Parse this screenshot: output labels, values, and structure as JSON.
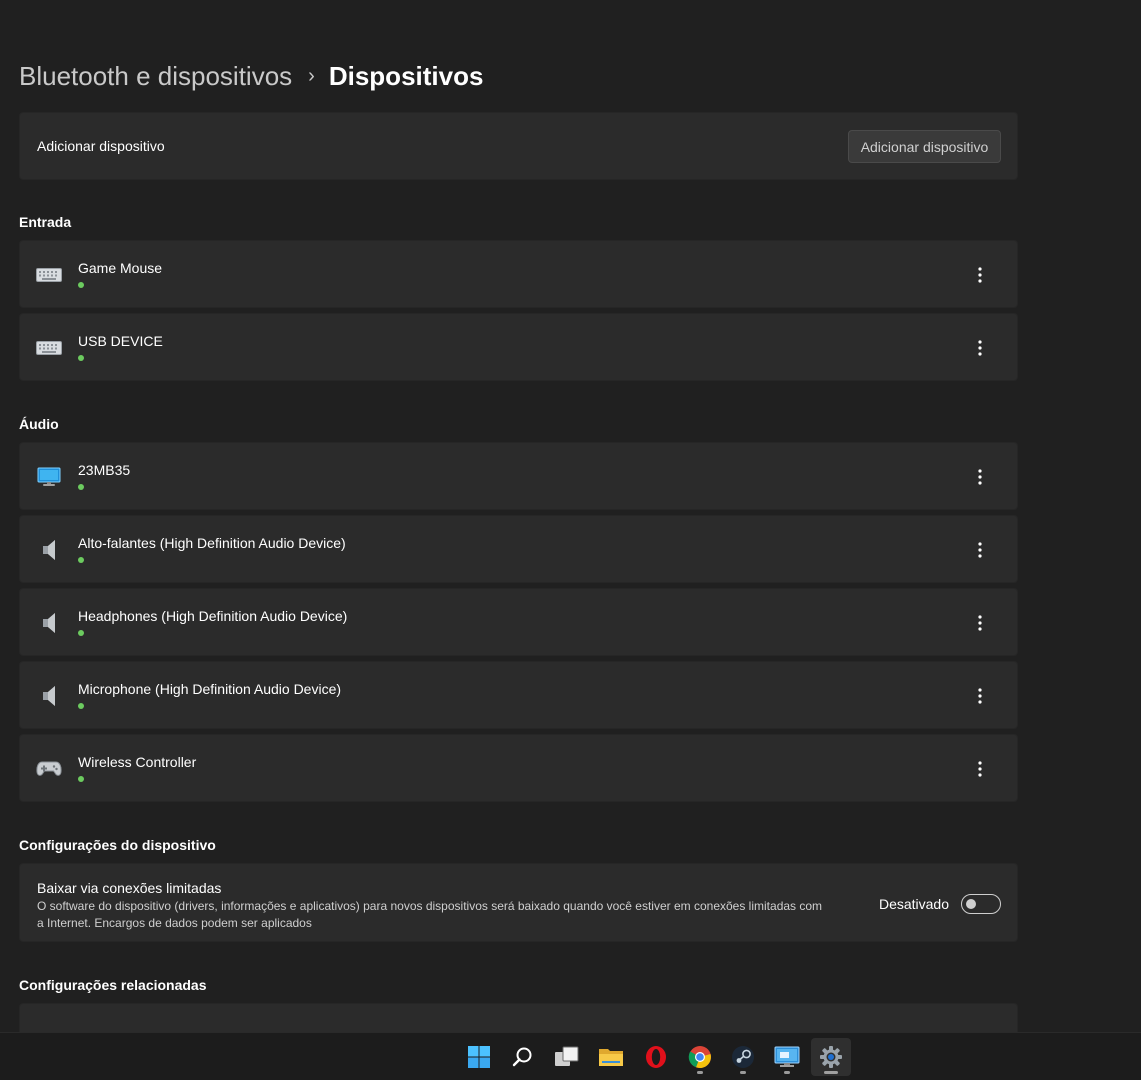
{
  "breadcrumb": {
    "parent": "Bluetooth e dispositivos",
    "separator": "›",
    "current": "Dispositivos"
  },
  "add_device": {
    "label": "Adicionar dispositivo",
    "button": "Adicionar dispositivo"
  },
  "sections": {
    "input": "Entrada",
    "audio": "Áudio",
    "device_settings": "Configurações do dispositivo",
    "related_settings": "Configurações relacionadas"
  },
  "input_devices": [
    {
      "name": "Game Mouse",
      "icon": "keyboard-icon",
      "status": "connected"
    },
    {
      "name": "USB DEVICE",
      "icon": "keyboard-icon",
      "status": "connected"
    }
  ],
  "audio_devices": [
    {
      "name": "23MB35",
      "icon": "monitor-icon",
      "status": "connected"
    },
    {
      "name": "Alto-falantes (High Definition Audio Device)",
      "icon": "speaker-icon",
      "status": "connected"
    },
    {
      "name": "Headphones (High Definition Audio Device)",
      "icon": "speaker-icon",
      "status": "connected"
    },
    {
      "name": "Microphone (High Definition Audio Device)",
      "icon": "speaker-icon",
      "status": "connected"
    },
    {
      "name": "Wireless Controller",
      "icon": "gamepad-icon",
      "status": "connected"
    }
  ],
  "metered_download": {
    "title": "Baixar via conexões limitadas",
    "description": "O software do dispositivo (drivers, informações e aplicativos) para novos dispositivos será baixado quando você estiver em conexões limitadas com a Internet. Encargos de dados podem ser aplicados",
    "state_label": "Desativado",
    "enabled": false
  },
  "colors": {
    "background": "#202020",
    "card": "#2b2b2b",
    "status_connected": "#6ccb5f",
    "windows_blue": "#4cc2ff"
  },
  "taskbar": [
    {
      "icon": "windows-start-icon",
      "running": false,
      "active": false
    },
    {
      "icon": "search-icon",
      "running": false,
      "active": false
    },
    {
      "icon": "task-view-icon",
      "running": false,
      "active": false
    },
    {
      "icon": "file-explorer-icon",
      "running": false,
      "active": false
    },
    {
      "icon": "opera-icon",
      "running": false,
      "active": false
    },
    {
      "icon": "chrome-icon",
      "running": true,
      "active": false
    },
    {
      "icon": "steam-icon",
      "running": true,
      "active": false
    },
    {
      "icon": "remote-desktop-icon",
      "running": true,
      "active": false
    },
    {
      "icon": "settings-icon",
      "running": true,
      "active": true
    }
  ]
}
